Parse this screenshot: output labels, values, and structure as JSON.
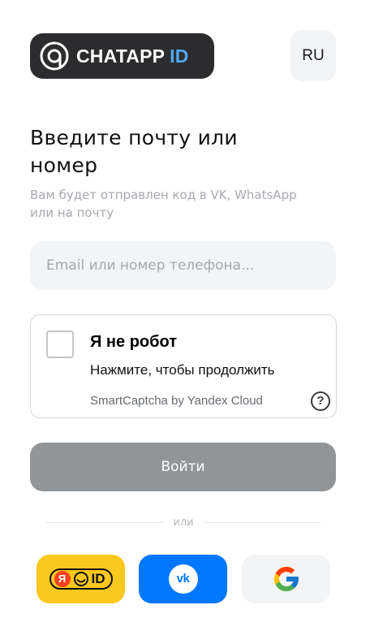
{
  "header": {
    "logo_name": "CHATAPP",
    "logo_suffix": "ID",
    "language": "RU"
  },
  "form": {
    "title": "Введите почту или номер",
    "subtitle": "Вам будет отправлен код в VK, WhatsApp или на почту",
    "input_placeholder": "Email или номер телефона...",
    "input_value": ""
  },
  "captcha": {
    "title": "Я не робот",
    "subtitle": "Нажмите, чтобы продолжить",
    "brand": "SmartCaptcha by Yandex Cloud",
    "help_glyph": "?",
    "checked": false
  },
  "login_label": "Войти",
  "divider_text": "или",
  "social": {
    "yandex": {
      "icon": "yandex-id-icon",
      "glyph_ya": "Я",
      "glyph_id": "ID"
    },
    "vk": {
      "icon": "vk-icon",
      "glyph": "vk"
    },
    "google": {
      "icon": "google-icon"
    }
  },
  "colors": {
    "login_button": "#929598",
    "yandex_button": "#fbc81e",
    "vk_button": "#0077ff",
    "logo_background": "#2c2c2e",
    "logo_accent": "#4fa9f5"
  }
}
